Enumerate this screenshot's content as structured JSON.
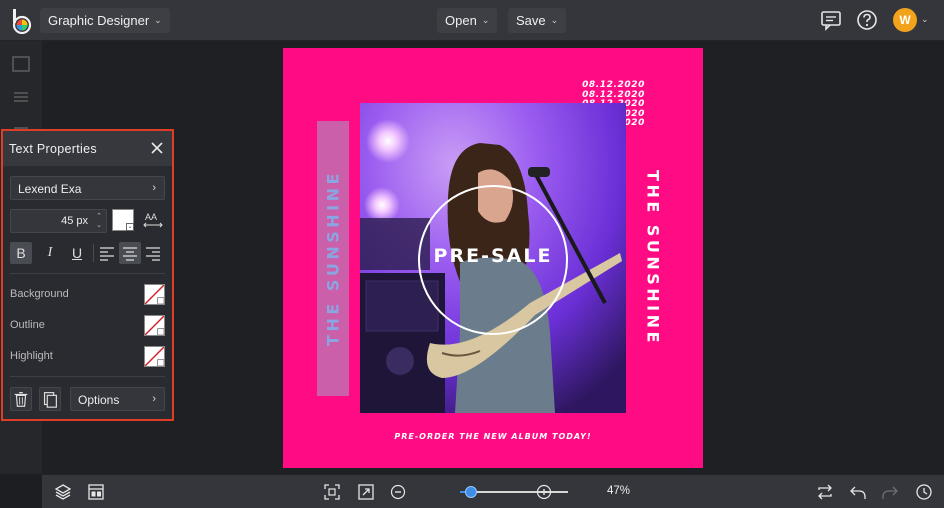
{
  "app": {
    "workspace_menu": "Graphic Designer",
    "open_label": "Open",
    "save_label": "Save",
    "avatar_initial": "W",
    "accent_color": "#f2a31b"
  },
  "icons": {
    "top_right": [
      "comment-icon",
      "help-icon"
    ],
    "left_rail": [
      "layers-icon",
      "adjust-icon",
      "image-icon"
    ],
    "bottom_left": [
      "layers-icon",
      "layout-icon"
    ],
    "bottom_center": [
      "fit-screen-icon",
      "expand-icon",
      "zoom-out-icon",
      "zoom-in-icon"
    ],
    "bottom_right": [
      "flip-icon",
      "undo-icon",
      "redo-icon",
      "history-icon"
    ]
  },
  "panel": {
    "title": "Text Properties",
    "font_name": "Lexend Exa",
    "font_size": "45 px",
    "text_color": "#ffffff",
    "format_buttons": [
      "B",
      "I",
      "U"
    ],
    "alignment": "center",
    "background_label": "Background",
    "outline_label": "Outline",
    "highlight_label": "Highlight",
    "options_label": "Options"
  },
  "design": {
    "background_color": "#ff0c85",
    "dates": [
      "08.12.2020",
      "08.12.2020",
      "08.12.2020",
      "08.12.2020",
      "08.12.2020"
    ],
    "vertical_left": "THE SUNSHINE",
    "vertical_right": "THE SUNSHINE",
    "center_text": "PRE-SALE",
    "footer_text": "PRE-ORDER THE NEW ALBUM TODAY!"
  },
  "zoom": {
    "value_label": "47%",
    "value": 0.1
  }
}
